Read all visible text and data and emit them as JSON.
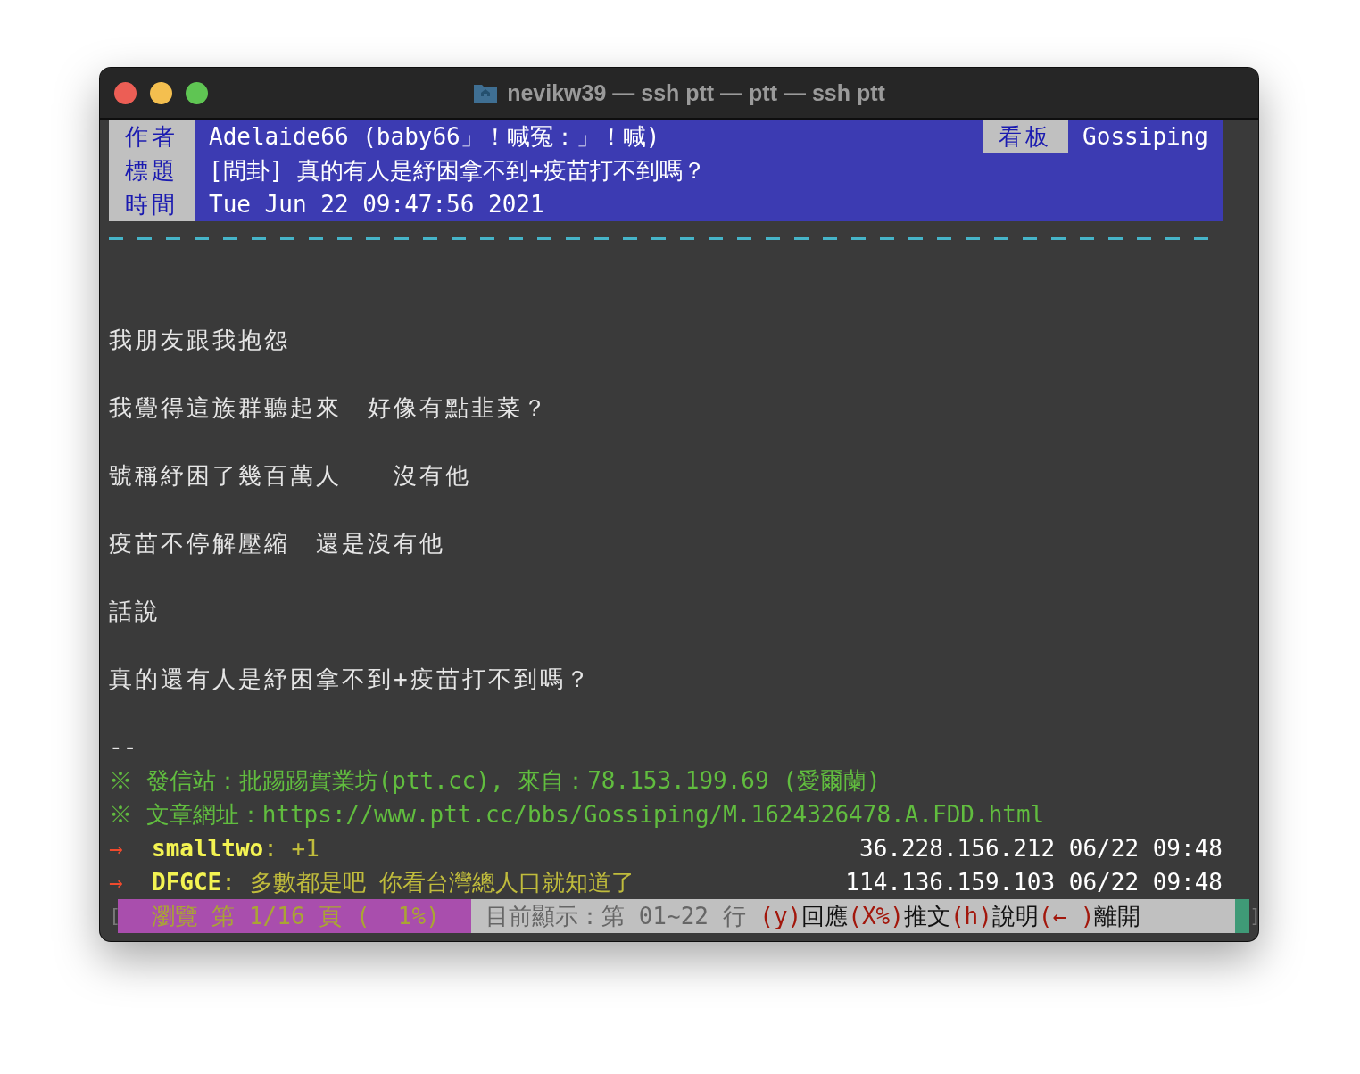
{
  "window": {
    "title": "nevikw39 — ssh ptt — ptt — ssh ptt"
  },
  "header": {
    "rows": [
      {
        "label": "作者",
        "value": "Adelaide66 (baby66」！喊冤：」！喊)"
      },
      {
        "label": "標題",
        "value": "[問卦] 真的有人是紓困拿不到+疫苗打不到嗎？"
      },
      {
        "label": "時間",
        "value": "Tue Jun 22 09:47:56 2021"
      }
    ],
    "board": {
      "label": "看板",
      "value": "Gossiping"
    }
  },
  "body": [
    "我朋友跟我抱怨",
    "我覺得這族群聽起來　好像有點韭菜？",
    "號稱紓困了幾百萬人　　沒有他",
    "疫苗不停解壓縮　還是沒有他",
    "話說",
    "真的還有人是紓困拿不到+疫苗打不到嗎？"
  ],
  "signature_mark": "--",
  "signature": [
    "※ 發信站：批踢踢實業坊(ptt.cc), 來自：78.153.199.69 (愛爾蘭)",
    "※ 文章網址：https://www.ptt.cc/bbs/Gossiping/M.1624326478.A.FDD.html"
  ],
  "pushes": [
    {
      "tag": "→",
      "user": "smalltwo",
      "content": ": +1",
      "meta": "36.228.156.212 06/22 09:48"
    },
    {
      "tag": "→",
      "user": "DFGCE",
      "content": ": 多數都是吧 你看台灣總人口就知道了",
      "meta": "114.136.159.103 06/22 09:48"
    }
  ],
  "status_bar": {
    "left_bracket": "[",
    "position": " 瀏覽 第 1/16 頁 (  1%) ",
    "lines": " 目前顯示：第 01~22 行 ",
    "hints": [
      {
        "key": "(y)",
        "label": "回應"
      },
      {
        "key": "(X%)",
        "label": "推文"
      },
      {
        "key": "(h)",
        "label": "說明"
      },
      {
        "key": "(← )",
        "label": "離開"
      }
    ],
    "right_bracket": "]"
  }
}
